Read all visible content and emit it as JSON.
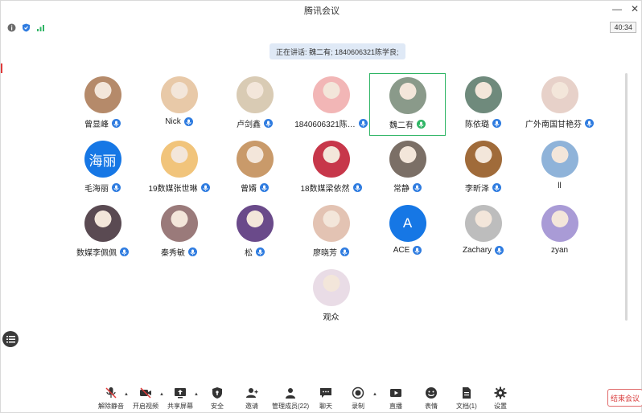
{
  "window": {
    "title": "腾讯会议",
    "minimize": "—",
    "close": "✕"
  },
  "status": {
    "timer": "40:34"
  },
  "speaking": {
    "text": "正在讲话: 魏二有; 1840606321陈学良;"
  },
  "participants": [
    {
      "name": "曾显峰",
      "avatar_color": "#b58a6a"
    },
    {
      "name": "Nick",
      "avatar_color": "#e8c9a8"
    },
    {
      "name": "卢剑鑫",
      "avatar_color": "#d9cbb4"
    },
    {
      "name": "1840606321陈…",
      "avatar_color": "#f2b6b6"
    },
    {
      "name": "魏二有",
      "avatar_color": "#8a9a8a"
    },
    {
      "name": "陈依璐",
      "avatar_color": "#6f8a7c"
    },
    {
      "name": "广外南国甘艳芬",
      "avatar_color": "#e7d1c9"
    },
    {
      "name": "毛海丽",
      "avatar_text": "海丽",
      "avatar_color": "#1677e5"
    },
    {
      "name": "19数媒张世琳",
      "avatar_color": "#f1c47b"
    },
    {
      "name": "曾婿",
      "avatar_color": "#c99a6a"
    },
    {
      "name": "18数媒梁依然",
      "avatar_color": "#c7374a"
    },
    {
      "name": "常静",
      "avatar_color": "#7b6f66"
    },
    {
      "name": "李昕泽",
      "avatar_color": "#a06b3a"
    },
    {
      "name": "ll",
      "avatar_color": "#8fb3d9"
    },
    {
      "name": "数媒李佩佩",
      "avatar_color": "#5a4a52"
    },
    {
      "name": "秦秀敏",
      "avatar_color": "#9a7a7a"
    },
    {
      "name": "松",
      "avatar_color": "#6a4a8a"
    },
    {
      "name": "廖晓芳",
      "avatar_color": "#e3c3b3"
    },
    {
      "name": "ACE",
      "avatar_text": "A",
      "avatar_color": "#1677e5"
    },
    {
      "name": "Zachary",
      "avatar_color": "#bdbdbd"
    },
    {
      "name": "zyan",
      "avatar_color": "#a99bd6"
    },
    {
      "name": "观众",
      "avatar_color": "#e9dce6"
    }
  ],
  "toolbar": {
    "unmute": "解除静音",
    "video": "开启视频",
    "share": "共享屏幕",
    "security": "安全",
    "invite": "邀请",
    "members": "管理成员(22)",
    "chat": "聊天",
    "record": "录制",
    "live": "直播",
    "emoji": "表情",
    "docs": "文档(1)",
    "settings": "设置",
    "end": "结束会议"
  }
}
